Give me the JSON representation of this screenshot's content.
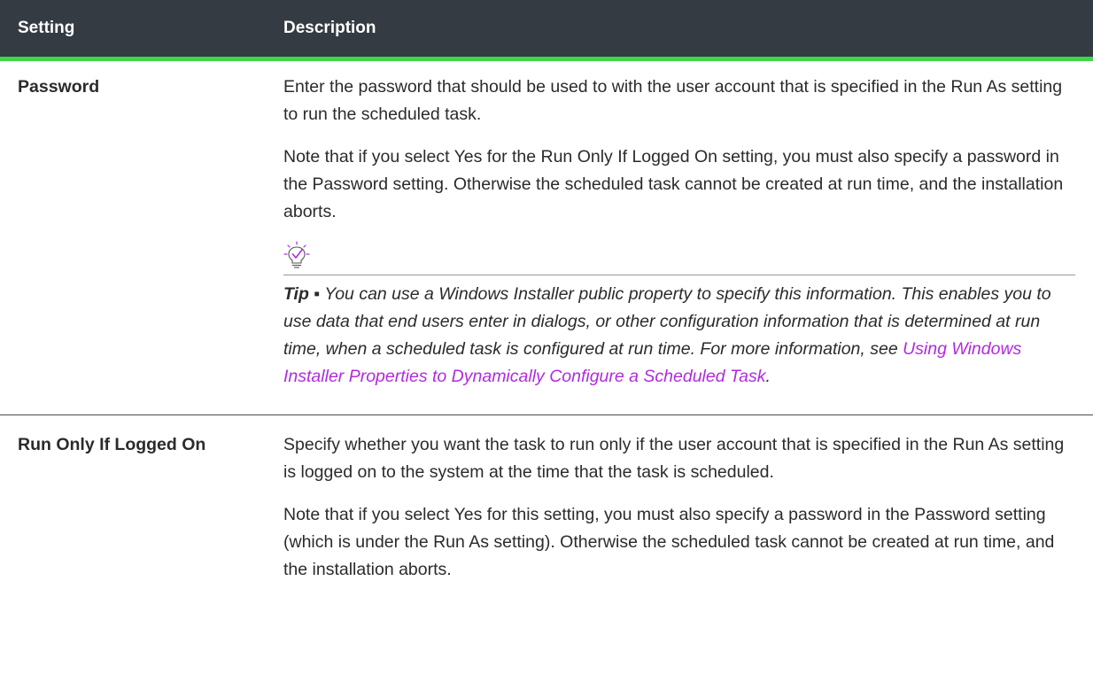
{
  "table": {
    "headers": {
      "setting": "Setting",
      "description": "Description"
    },
    "rows": [
      {
        "name": "Password",
        "paragraphs": [
          "Enter the password that should be used to with the user account that is specified in the Run As setting to run the scheduled task.",
          "Note that if you select Yes for the Run Only If Logged On setting, you must also specify a password in the Password setting. Otherwise the scheduled task cannot be created at run time, and the installation aborts."
        ],
        "tip": {
          "icon": "lightbulb-check-icon",
          "label": "Tip ▪",
          "text": " You can use a Windows Installer public property to specify this information. This enables you to use data that end users enter in dialogs, or other configuration information that is determined at run time, when a scheduled task is configured at run time. For more information, see ",
          "link": "Using Windows Installer Properties to Dynamically Configure a Scheduled Task",
          "end": "."
        }
      },
      {
        "name": "Run Only If Logged On",
        "paragraphs": [
          "Specify whether you want the task to run only if the user account that is specified in the Run As setting is logged on to the system at the time that the task is scheduled.",
          "Note that if you select Yes for this setting, you must also specify a password in the Password setting (which is under the Run As setting). Otherwise the scheduled task cannot be created at run time, and the installation aborts."
        ]
      }
    ]
  },
  "colors": {
    "header_bg": "#343b42",
    "header_accent": "#3fd44a",
    "link": "#b12ae0",
    "icon": "#b12ae0"
  }
}
